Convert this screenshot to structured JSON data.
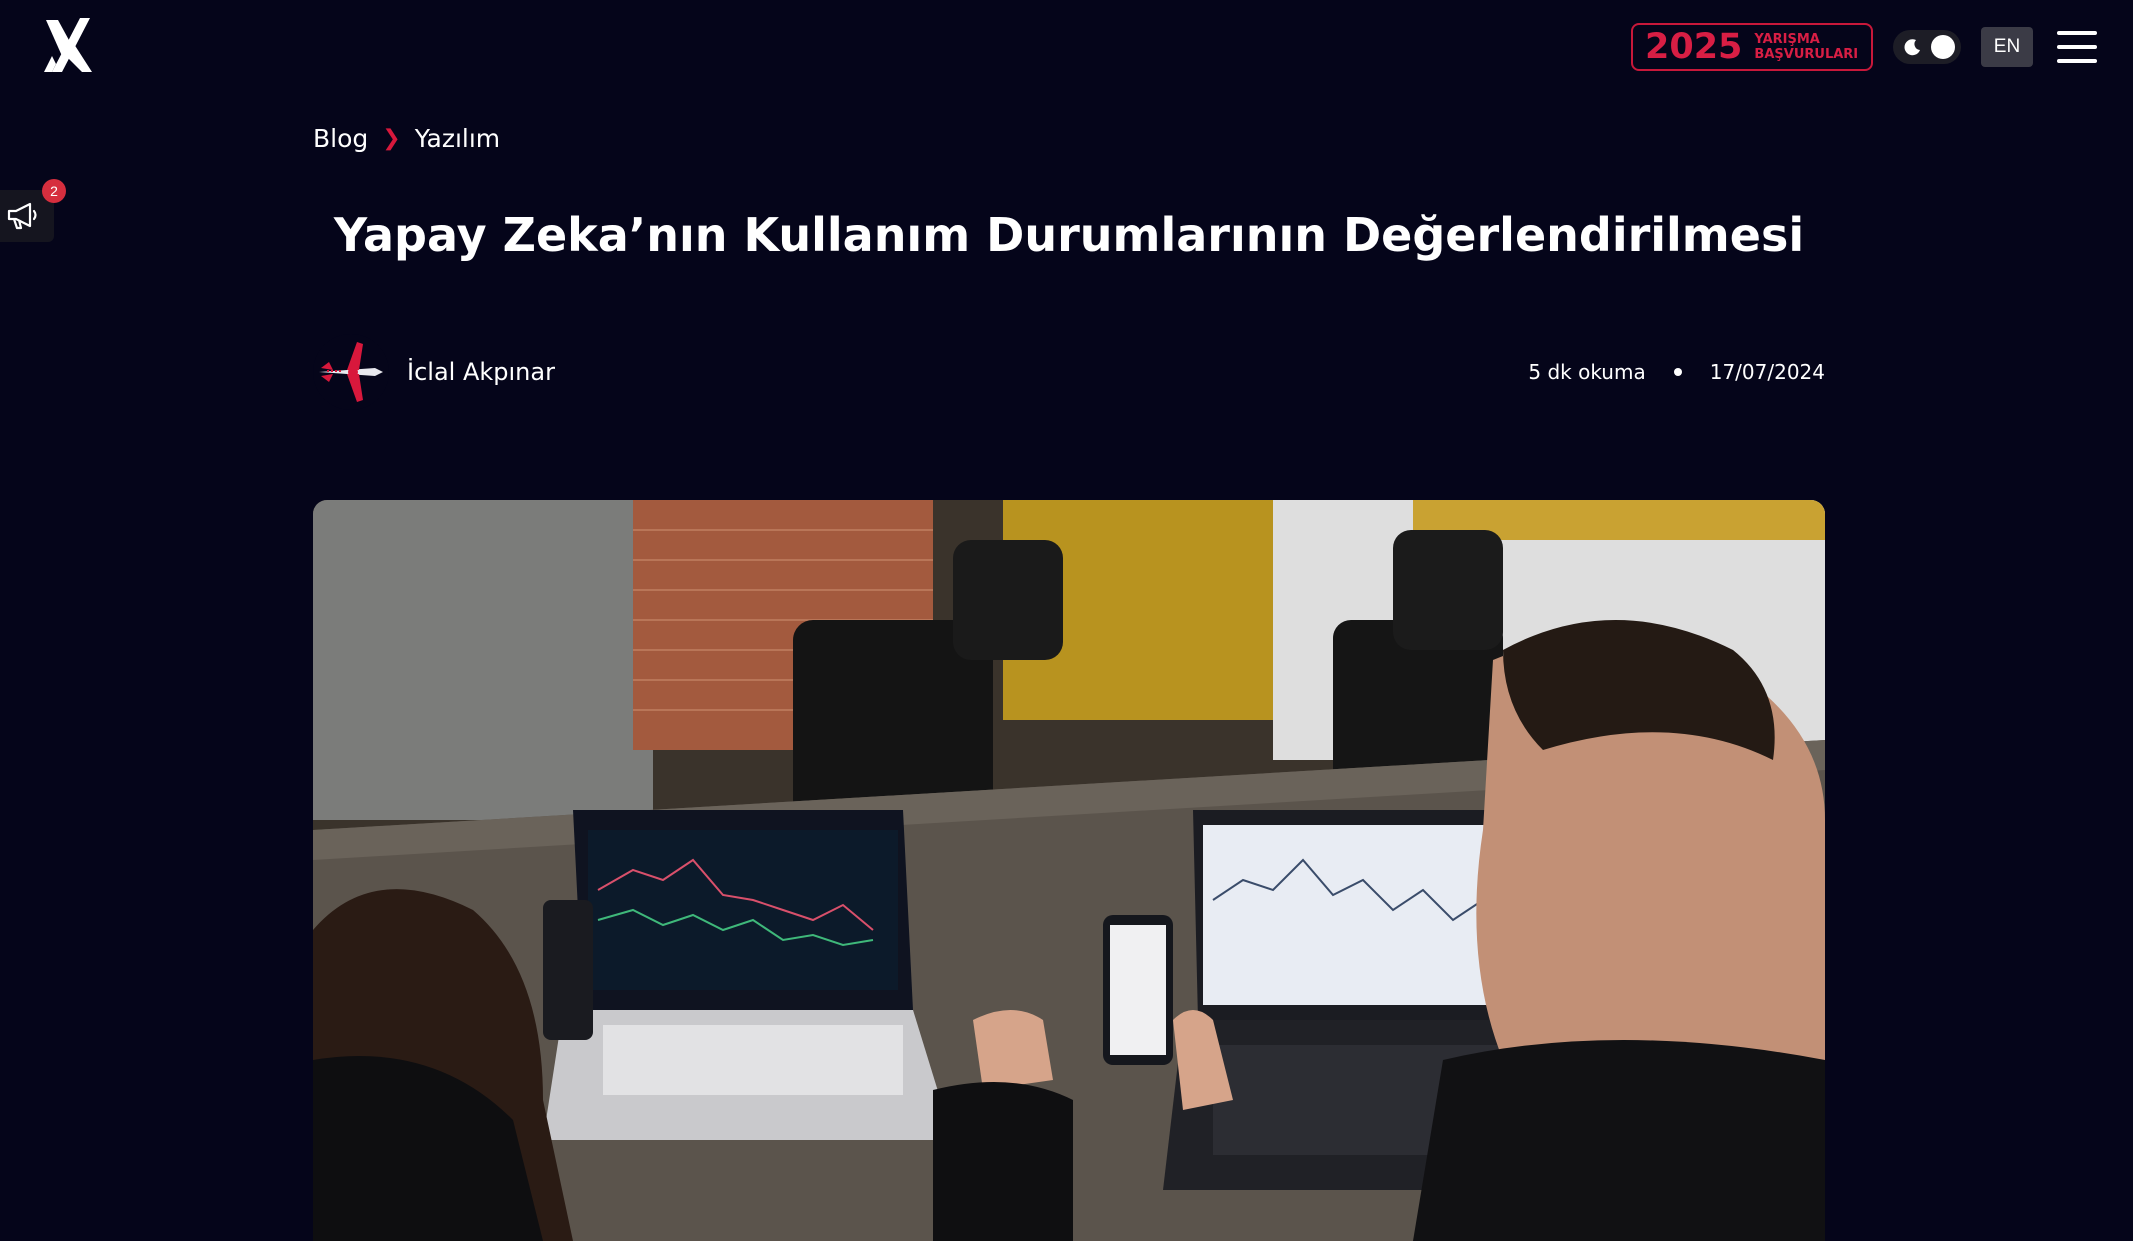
{
  "header": {
    "competition": {
      "year": "2025",
      "line1": "YARIŞMA",
      "line2": "BAŞVURULARI"
    },
    "language": "EN",
    "icons": {
      "logo": "logo-icon",
      "theme": "moon-icon",
      "menu": "hamburger-menu-icon"
    }
  },
  "announcements": {
    "count": "2",
    "icon": "megaphone-icon"
  },
  "breadcrumb": {
    "items": [
      "Blog",
      "Yazılım"
    ]
  },
  "article": {
    "title": "Yapay Zeka’nın Kullanım Durumlarının Değerlendirilmesi",
    "author": "İclal Akpınar",
    "read_time": "5 dk okuma",
    "date": "17/07/2024"
  },
  "colors": {
    "background": "#05051a",
    "accent": "#d81e44",
    "badge": "#d62e3e",
    "lang_button": "#3b3b46"
  }
}
